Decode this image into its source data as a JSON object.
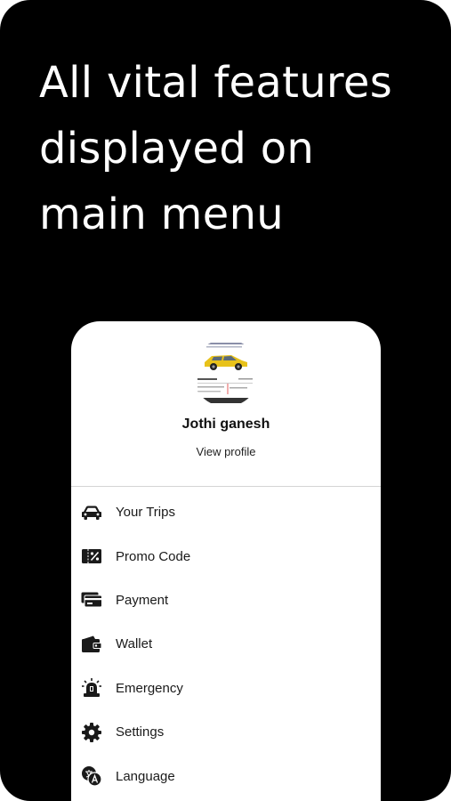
{
  "headline": {
    "line1": "All vital features",
    "line2": "displayed on",
    "line3": "main menu"
  },
  "profile": {
    "name": "Jothi ganesh",
    "view_profile_label": "View profile"
  },
  "menu": {
    "items": [
      {
        "label": "Your Trips",
        "icon": "car-icon"
      },
      {
        "label": "Promo Code",
        "icon": "promo-ticket-icon"
      },
      {
        "label": "Payment",
        "icon": "credit-card-icon"
      },
      {
        "label": "Wallet",
        "icon": "wallet-icon"
      },
      {
        "label": "Emergency",
        "icon": "siren-icon"
      },
      {
        "label": "Settings",
        "icon": "gear-icon"
      },
      {
        "label": "Language",
        "icon": "language-icon"
      }
    ]
  },
  "colors": {
    "background": "#000000",
    "panel": "#ffffff",
    "text": "#1a1a1a",
    "avatar_car": "#e8c21a"
  }
}
